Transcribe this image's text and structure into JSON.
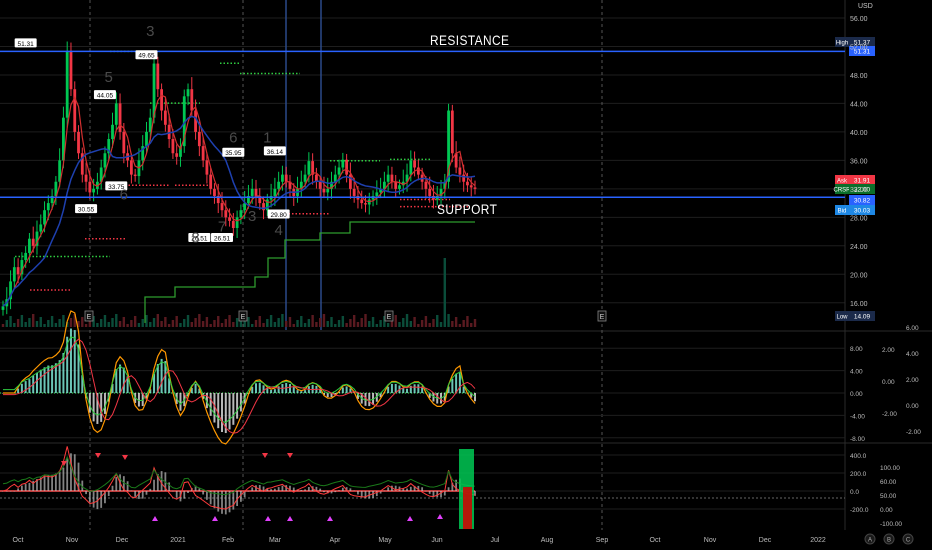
{
  "chart_data": {
    "type": "line",
    "title": "",
    "currency": "USD",
    "y_ticks": [
      "56.00",
      "52.00",
      "48.00",
      "44.00",
      "40.00",
      "36.00",
      "32.00",
      "28.00",
      "24.00",
      "20.00",
      "16.00"
    ],
    "x_ticks": [
      "Oct",
      "Nov",
      "Dec",
      "2021",
      "Feb",
      "Mar",
      "Apr",
      "May",
      "Jun",
      "Jul",
      "Aug",
      "Sep",
      "Oct",
      "Nov",
      "Dec",
      "2022"
    ],
    "ylim": [
      13,
      58
    ],
    "price_labels": {
      "high": {
        "label": "High",
        "value": "51.37"
      },
      "high2": {
        "value": "51.31"
      },
      "ask": {
        "label": "Ask",
        "value": "31.91"
      },
      "symbol": {
        "label": "CRSR",
        "value": "32.00"
      },
      "mid": {
        "value": "30.82"
      },
      "bid": {
        "label": "Bid",
        "value": "30.03"
      },
      "low": {
        "label": "Low",
        "value": "14.09"
      }
    },
    "annotations": {
      "resistance": "RESISTANCE",
      "support": "SUPPORT",
      "resistance_level": 51.31,
      "support_level": 30.82
    },
    "peak_labels": [
      {
        "text": "51.31",
        "x": 6,
        "y": 51.31
      },
      {
        "text": "44.05",
        "x": 27,
        "y": 44.05
      },
      {
        "text": "49.65",
        "x": 38,
        "y": 49.65
      },
      {
        "text": "35.95",
        "x": 61,
        "y": 35.95
      },
      {
        "text": "36.14",
        "x": 72,
        "y": 36.14
      }
    ],
    "trough_labels": [
      {
        "text": "30.55",
        "x": 22,
        "y": 30.55
      },
      {
        "text": "33.75",
        "x": 30,
        "y": 33.75
      },
      {
        "text": "26.51",
        "x": 52,
        "y": 26.51
      },
      {
        "text": "26.51",
        "x": 58,
        "y": 26.51
      },
      {
        "text": "29.80",
        "x": 73,
        "y": 29.8
      }
    ],
    "wave_numbers": [
      {
        "text": "3",
        "x": 39,
        "y": 53.5
      },
      {
        "text": "5",
        "x": 28,
        "y": 47
      },
      {
        "text": "6",
        "x": 32,
        "y": 30.5
      },
      {
        "text": "6",
        "x": 61,
        "y": 38.5
      },
      {
        "text": "1",
        "x": 70,
        "y": 38.5
      },
      {
        "text": "8",
        "x": 51,
        "y": 24.5
      },
      {
        "text": "7",
        "x": 58,
        "y": 26
      },
      {
        "text": "3",
        "x": 66,
        "y": 27.5
      },
      {
        "text": "4",
        "x": 73,
        "y": 25.5
      }
    ],
    "series": [
      {
        "name": "",
        "values": [
          15.5,
          16.5,
          19,
          21,
          20,
          22,
          23,
          25,
          24,
          26,
          27,
          29,
          30,
          31,
          33,
          36,
          42,
          51.3,
          46,
          40,
          37,
          34,
          33,
          31.5,
          32,
          33,
          35,
          37,
          39,
          41,
          44,
          40,
          37,
          36,
          34,
          33.8,
          36,
          38,
          40,
          42,
          49.6,
          46,
          43,
          41,
          39,
          37,
          36.5,
          38,
          45,
          46,
          43,
          40,
          38,
          36,
          34,
          32,
          31,
          30,
          29,
          28,
          27.5,
          26.5,
          28,
          29,
          30,
          31,
          32,
          31,
          30,
          29,
          30.5,
          31,
          32,
          33,
          34,
          33,
          32,
          31,
          32,
          33,
          34,
          35.9,
          34,
          33,
          32,
          31.5,
          32,
          33,
          34,
          35,
          36.1,
          34,
          32,
          31,
          30.5,
          30,
          29.8,
          30.5,
          31,
          31.5,
          32,
          33,
          34,
          33,
          32,
          32.5,
          33,
          34,
          36,
          35,
          34,
          33,
          32,
          31,
          30.5,
          31,
          32,
          33,
          43,
          37,
          35,
          34,
          33,
          32.5,
          32.2,
          32
        ]
      }
    ],
    "indicator_macd_ticks": [
      "8.00",
      "4.00",
      "0.00",
      "-4.00",
      "-8.00"
    ],
    "indicator_macd_ticks2": [
      "2.00",
      "0.00",
      "-2.00"
    ],
    "indicator_macd_ticks3": [
      "6.00",
      "4.00",
      "2.00",
      "0.00",
      "-2.00"
    ],
    "indicator_osc_ticks": [
      "400.0",
      "200.0",
      "0.0",
      "-200.0"
    ],
    "indicator_osc_ticks2": [
      "100.00",
      "60.00",
      "50.00",
      "0.00",
      "-100.00"
    ]
  },
  "ui": {
    "earnings_marker": "E",
    "scale_buttons": [
      "A",
      "B",
      "C"
    ]
  },
  "colors": {
    "background": "#000000",
    "up": "#089981",
    "up_bright": "#00c853",
    "down": "#f23645",
    "grid": "#1e1e1e",
    "support_line": "#2962ff",
    "resistance_line": "#2962ff"
  }
}
